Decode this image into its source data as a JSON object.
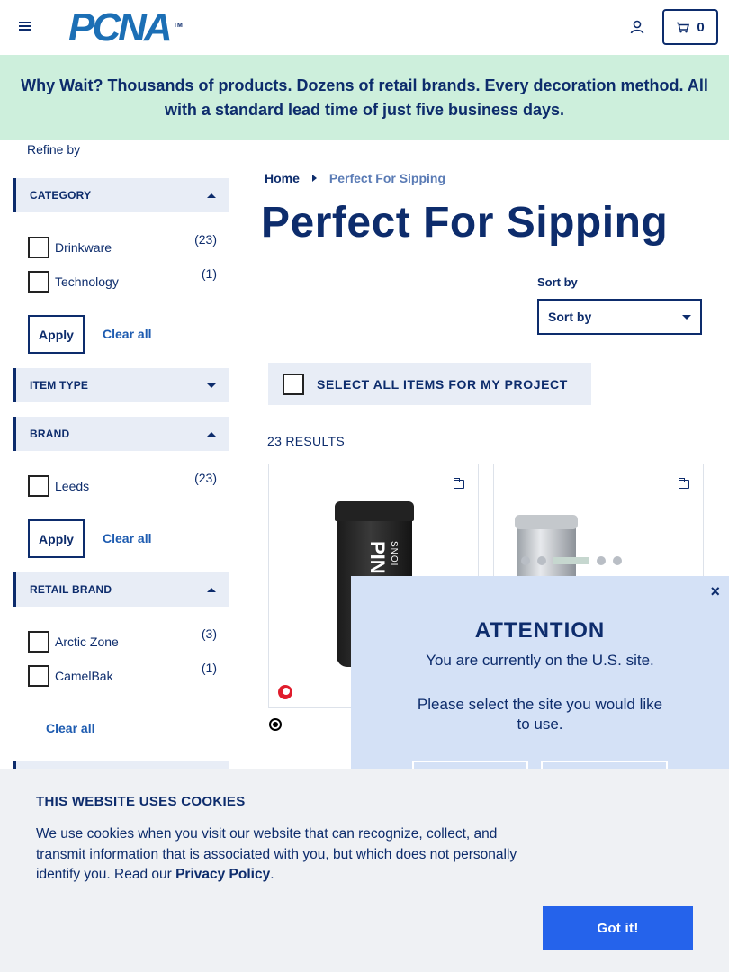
{
  "header": {
    "logo_text": "PCNA",
    "logo_tm": "TM",
    "cart_count": "0"
  },
  "banner": {
    "text": "Why Wait? Thousands of products. Dozens of retail brands. Every decoration method. All with a standard lead time of just five business days."
  },
  "sidebar": {
    "refine_label": "Refine by",
    "facets": {
      "category": {
        "label": "CATEGORY",
        "state": "expanded",
        "options": [
          {
            "label": "Drinkware",
            "count": "(23)"
          },
          {
            "label": "Technology",
            "count": "(1)"
          }
        ],
        "apply": "Apply",
        "clear": "Clear all"
      },
      "item_type": {
        "label": "ITEM TYPE",
        "state": "collapsed"
      },
      "brand": {
        "label": "BRAND",
        "state": "expanded",
        "options": [
          {
            "label": "Leeds",
            "count": "(23)"
          }
        ],
        "apply": "Apply",
        "clear": "Clear all"
      },
      "retail_brand": {
        "label": "RETAIL BRAND",
        "state": "expanded",
        "options": [
          {
            "label": "Arctic Zone",
            "count": "(3)"
          },
          {
            "label": "CamelBak",
            "count": "(1)"
          }
        ],
        "clear": "Clear all"
      }
    }
  },
  "main": {
    "breadcrumb": {
      "home": "Home",
      "current": "Perfect For Sipping"
    },
    "title": "Perfect For Sipping",
    "sort": {
      "label": "Sort by",
      "selected": "Sort by"
    },
    "select_all": "SELECT ALL ITEMS FOR MY PROJECT",
    "results": "23 RESULTS",
    "products": [
      {
        "print_big": "PIN",
        "print_small": "SNOI",
        "swatches": [
          "#e01c2c"
        ],
        "extra_swatches": [
          "#000000"
        ]
      },
      {
        "swatches": []
      }
    ]
  },
  "attention_modal": {
    "close": "×",
    "title": "ATTENTION",
    "line1": "You are currently on the U.S. site.",
    "line2": "Please select the site you would like to use."
  },
  "cookie": {
    "title": "THIS WEBSITE USES COOKIES",
    "body": "We use cookies when you visit our website that can recognize, collect, and transmit information that is associated with you, but which does not personally identify you. Read our ",
    "policy_link": "Privacy Policy",
    "period": ".",
    "button": "Got it!"
  },
  "colors": {
    "navy": "#0d2c6c",
    "banner_bg": "#cdefdc",
    "facet_bg": "#e8edf6",
    "modal_bg": "#d4e1f6",
    "cookie_btn": "#2563eb"
  }
}
